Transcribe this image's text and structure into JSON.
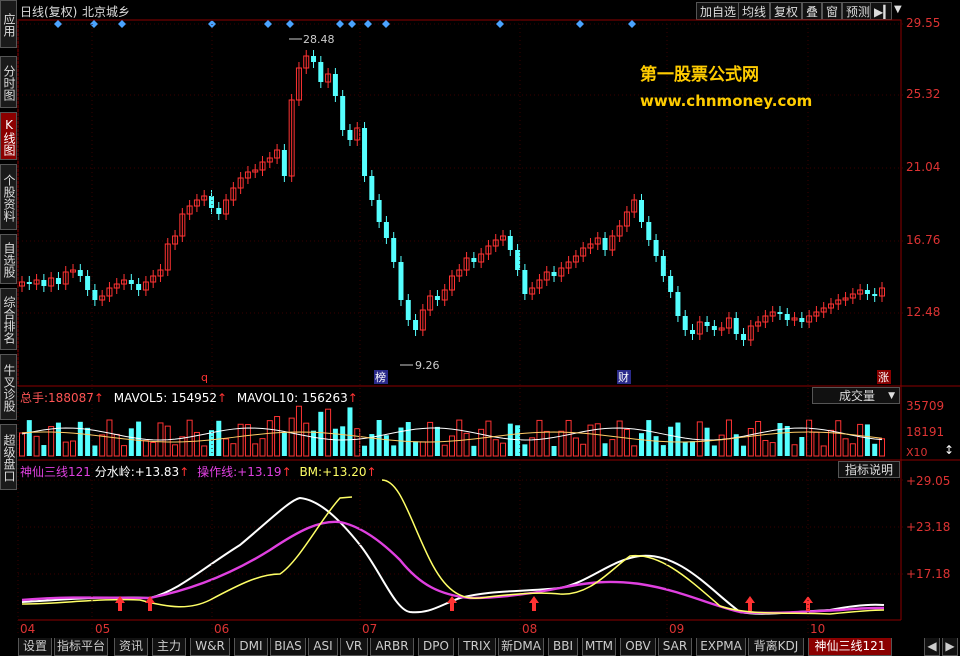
{
  "header": {
    "chart_title": "日线(复权)",
    "stock_name": "北京城乡",
    "buttons": [
      "加自选",
      "均线",
      "复权",
      "叠",
      "窗",
      "预测"
    ]
  },
  "left_tabs": [
    "应用",
    "分时图",
    "K线图",
    "个股资料",
    "自选股",
    "综合排名",
    "牛叉诊股",
    "超级盘口"
  ],
  "price_axis": [
    "29.55",
    "25.32",
    "21.04",
    "16.76",
    "12.48"
  ],
  "high_label": "28.48",
  "low_label": "9.26",
  "watermark": {
    "line1": "第一股票公式网",
    "line2": "www.chnmoney.com"
  },
  "markers": {
    "q": "q",
    "bang": "榜",
    "cai": "财",
    "zhang": "涨"
  },
  "volume": {
    "total_label": "总手:",
    "total_value": "188087",
    "ma5_label": "MAVOL5:",
    "ma5_value": "154952",
    "ma10_label": "MAVOL10:",
    "ma10_value": "156263",
    "button": "成交量",
    "axis": [
      "35709",
      "18191"
    ],
    "unit": "X10"
  },
  "indicator": {
    "name": "神仙三线121",
    "line1_label": "分水岭:",
    "line1_value": "+13.83",
    "line2_label": "操作线:",
    "line2_value": "+13.19",
    "line3_label": "BM:",
    "line3_value": "+13.20",
    "button": "指标说明",
    "axis": [
      "+29.05",
      "+23.18",
      "+17.18"
    ]
  },
  "months": [
    "04",
    "05",
    "06",
    "07",
    "08",
    "09",
    "10"
  ],
  "bottom_tabs": [
    "设置",
    "指标平台",
    "资讯",
    "主力",
    "W&R",
    "DMI",
    "BIAS",
    "ASI",
    "VR",
    "ARBR",
    "DPO",
    "TRIX",
    "新DMA",
    "BBI",
    "MTM",
    "OBV",
    "SAR",
    "EXPMA",
    "背离KDJ",
    "神仙三线121"
  ],
  "colors": {
    "up": "#ff3333",
    "down": "#55ffff",
    "white_line": "#ffffff",
    "magenta_line": "#e040e0",
    "yellow_line": "#ffff66",
    "axis": "#cc2222"
  }
}
